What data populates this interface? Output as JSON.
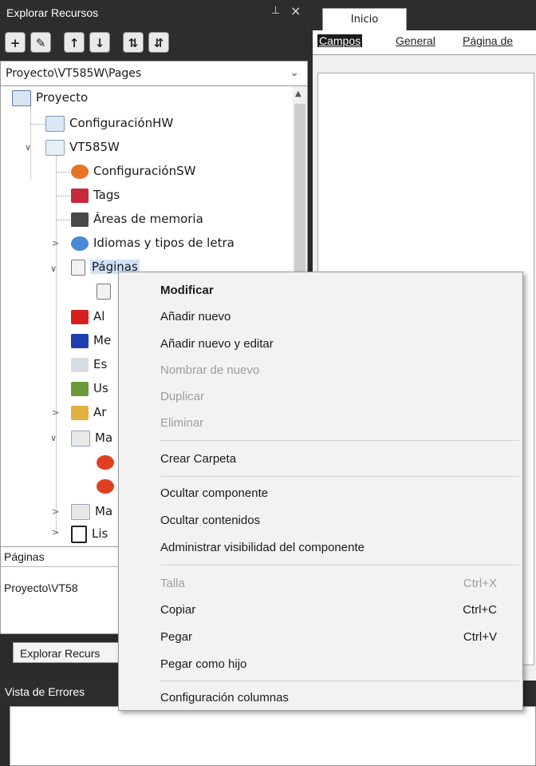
{
  "explorer": {
    "title": "Explorar Recursos",
    "pin": "⊥",
    "close": "×",
    "path": "Proyecto\\VT585W\\Pages",
    "tree": {
      "proyecto": "Proyecto",
      "config_hw": "ConfiguraciónHW",
      "vt585w": "VT585W",
      "config_sw": "ConfiguraciónSW",
      "tags": "Tags",
      "areas": "Áreas de memoria",
      "idiomas": "Idiomas y tipos de letra",
      "paginas": "Páginas",
      "al": "Al",
      "me": "Me",
      "es": "Es",
      "us": "Us",
      "ar": "Ar",
      "ma1": "Ma",
      "ma2": "Ma",
      "lis": "Lis"
    },
    "info": {
      "header": "Páginas",
      "value": "Proyecto\\VT58"
    },
    "bottom_tab": "Explorar Recurs"
  },
  "errors": {
    "title": "Vista de Errores"
  },
  "document": {
    "tab": "Inicio",
    "subnav": [
      "Campos",
      "General",
      "Página de"
    ]
  },
  "context_menu": {
    "items": [
      {
        "label": "Modificar",
        "shortcut": ""
      },
      {
        "label": "Añadir nuevo",
        "shortcut": ""
      },
      {
        "label": "Añadir nuevo y editar",
        "shortcut": ""
      },
      {
        "label": "Nombrar de nuevo",
        "shortcut": ""
      },
      {
        "label": "Duplicar",
        "shortcut": ""
      },
      {
        "label": "Eliminar",
        "shortcut": ""
      },
      {
        "label": "Crear Carpeta",
        "shortcut": ""
      },
      {
        "label": "Ocultar componente",
        "shortcut": ""
      },
      {
        "label": "Ocultar contenidos",
        "shortcut": ""
      },
      {
        "label": "Administrar visibilidad del componente",
        "shortcut": ""
      },
      {
        "label": "Talla",
        "shortcut": "Ctrl+X"
      },
      {
        "label": "Copiar",
        "shortcut": "Ctrl+C"
      },
      {
        "label": "Pegar",
        "shortcut": "Ctrl+V"
      },
      {
        "label": "Pegar como hijo",
        "shortcut": ""
      },
      {
        "label": "Configuración columnas",
        "shortcut": ""
      }
    ]
  }
}
